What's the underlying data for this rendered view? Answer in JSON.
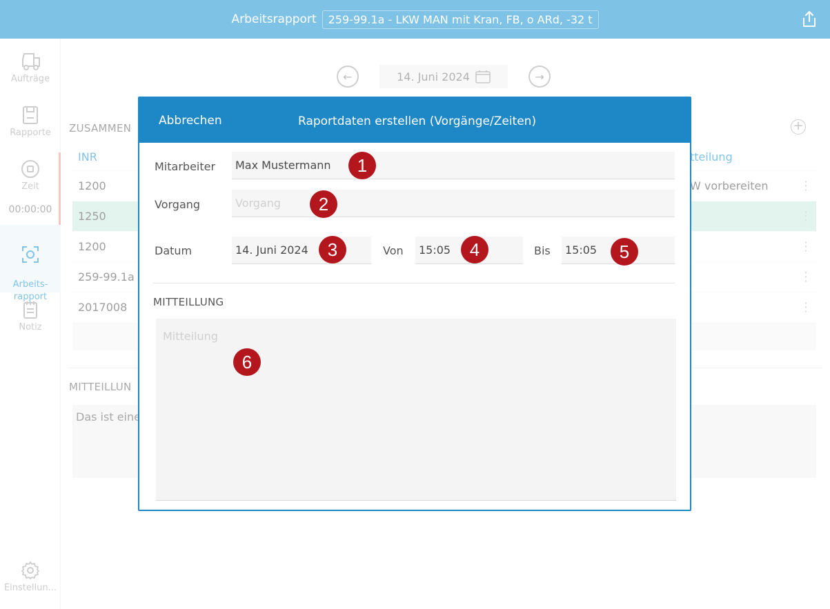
{
  "topbar": {
    "label": "Arbeitsrapport",
    "selected": "259-99.1a - LKW MAN mit Kran, FB, o ARd, -32 t",
    "share_icon": "share-icon"
  },
  "sidebar": {
    "items": [
      {
        "label": "Aufträge",
        "icon": "truck-icon"
      },
      {
        "label": "Rapporte",
        "icon": "save-icon"
      },
      {
        "label": "Zeit",
        "icon": "stop-icon"
      },
      {
        "label": "Arbeits-\nrapport",
        "icon": "target-icon"
      },
      {
        "label": "Notiz",
        "icon": "notepad-icon"
      },
      {
        "label": "Einstellun...",
        "icon": "gear-icon"
      }
    ],
    "time": "00:00:00"
  },
  "main": {
    "date": "14. Juni 2024",
    "summary_title": "ZUSAMMEN",
    "table_headers": [
      "INR",
      "tteilung"
    ],
    "rows": [
      {
        "inr": "1200",
        "msg": "W vorbereiten"
      },
      {
        "inr": "1250",
        "msg": ""
      },
      {
        "inr": "1200",
        "msg": ""
      },
      {
        "inr": "259-99.1a",
        "msg": ""
      },
      {
        "inr": "2017008",
        "msg": ""
      }
    ],
    "message_title": "MITTEILLUN",
    "message_text": "Das ist eine"
  },
  "modal": {
    "cancel": "Abbrechen",
    "title": "Raportdaten erstellen (Vorgänge/Zeiten)",
    "employee_label": "Mitarbeiter",
    "employee_value": "Max Mustermann",
    "process_label": "Vorgang",
    "process_placeholder": "Vorgang",
    "date_label": "Datum",
    "date_value": "14. Juni 2024",
    "from_label": "Von",
    "from_value": "15:05",
    "to_label": "Bis",
    "to_value": "15:05",
    "message_section": "MITTEILLUNG",
    "message_placeholder": "Mitteilung"
  },
  "badges": [
    "1",
    "2",
    "3",
    "4",
    "5",
    "6"
  ]
}
